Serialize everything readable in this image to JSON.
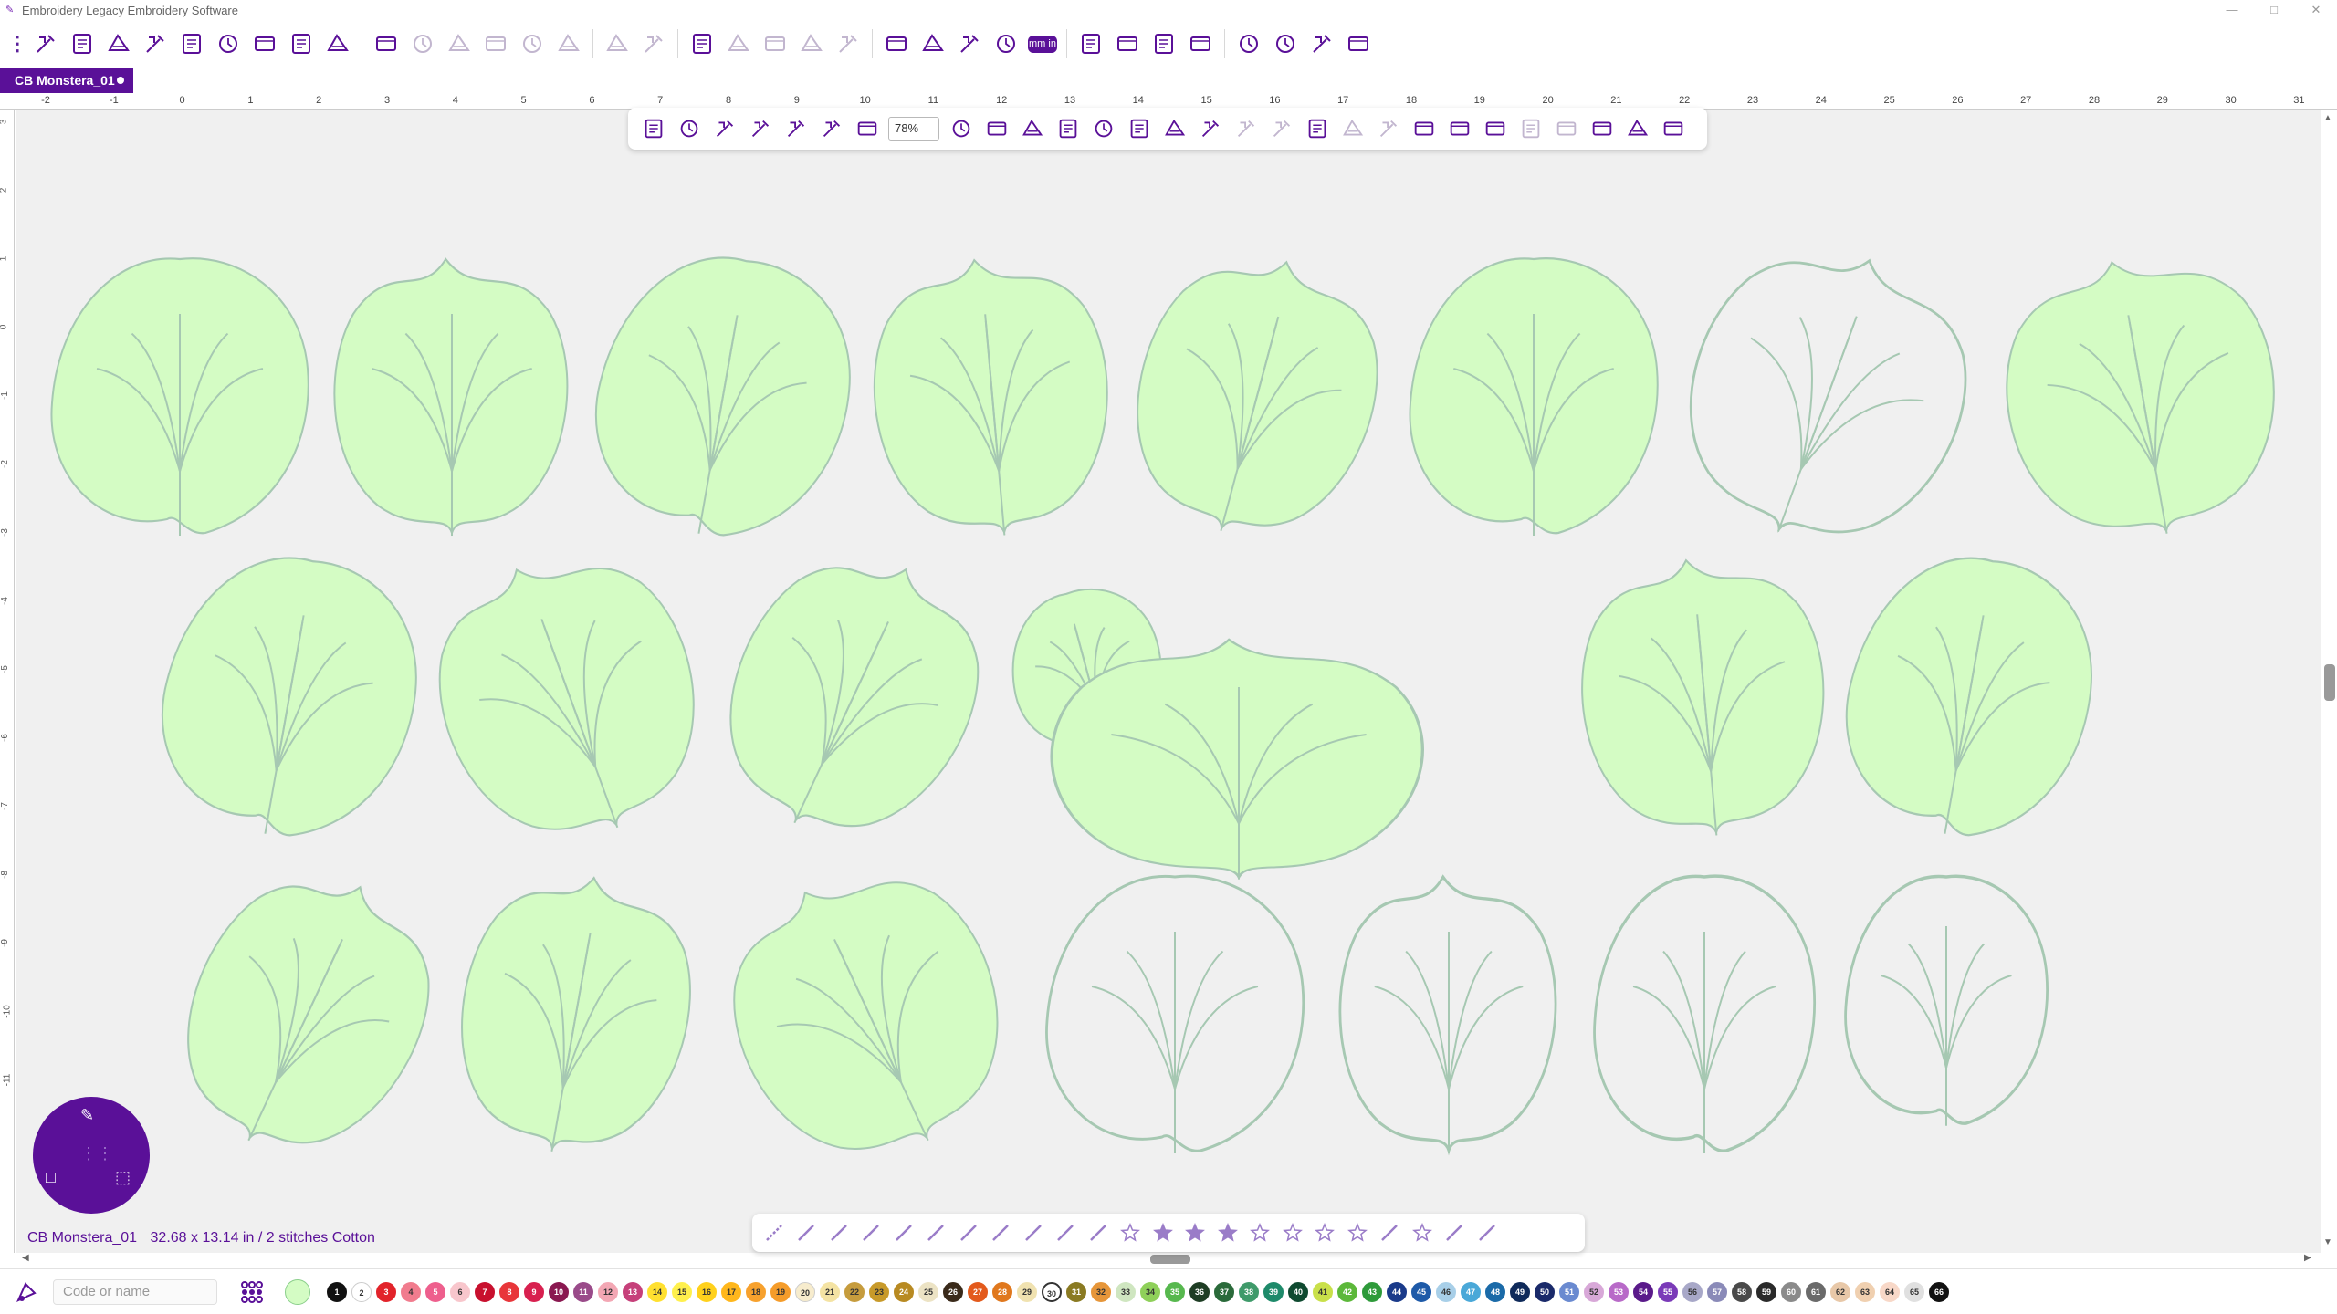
{
  "window": {
    "title": "Embroidery Legacy Embroidery Software",
    "controls": [
      "—",
      "□",
      "✕"
    ]
  },
  "toolbar": {
    "groups": [
      [
        "design-icon",
        "new-icon",
        "edit-icon",
        "open-icon",
        "open-folder-icon",
        "save-icon",
        "save-as-icon",
        "template-icon",
        "print-icon"
      ],
      [
        "undo-icon",
        "redo-icon",
        "cut-icon",
        "copy-icon",
        "paste-icon",
        "delete-icon"
      ],
      [
        "group-icon",
        "ungroup-icon"
      ],
      [
        "rotate-icon",
        "mirror-icon",
        "align-icon",
        "distribute-icon",
        "path-icon"
      ],
      [
        "hoop-icon",
        "grid-icon",
        "measure-icon",
        "center-icon",
        "units-icon"
      ],
      [
        "realistic-icon",
        "layers-toggle-icon",
        "image-icon",
        "frame-icon"
      ],
      [
        "properties-icon",
        "settings-icon",
        "stack-icon",
        "web-icon"
      ]
    ],
    "units_label": "mm in"
  },
  "document": {
    "tab_label": "CB Monstera_01"
  },
  "ruler": {
    "horizontal_ticks": [
      "-2",
      "-1",
      "0",
      "1",
      "2",
      "3",
      "4",
      "5",
      "6",
      "7",
      "8",
      "9",
      "10",
      "11",
      "12",
      "13",
      "14",
      "15",
      "16",
      "17",
      "18",
      "19",
      "20",
      "21",
      "22",
      "23",
      "24",
      "25",
      "26",
      "27",
      "28",
      "29",
      "30",
      "31"
    ],
    "vertical_ticks": [
      "3",
      "2",
      "1",
      "0",
      "-1",
      "-2",
      "-3",
      "-4",
      "-5",
      "-6",
      "-7",
      "-8",
      "-9",
      "-10",
      "-11"
    ]
  },
  "canvas_toolbar": {
    "zoom_value": "78%",
    "icons": [
      "select-icon",
      "lasso-icon",
      "select-box-icon",
      "select-points-icon",
      "3d-view-icon",
      "pan-icon",
      "zoom-icon",
      "zoom-value",
      "monitor-icon",
      "text-icon",
      "text-path-icon",
      "open-folder-icon",
      "save-icon",
      "save-design-icon",
      "edit-stitch-icon",
      "node-edit-icon",
      "curve-icon",
      "convert-icon",
      "arrow-icon",
      "cut-stitch-icon",
      "remove-icon",
      "stitch-player-icon",
      "auto-digitize-icon",
      "fill-icon",
      "applique-icon",
      "magic-icon",
      "density-icon",
      "image-edit-icon",
      "resize-icon"
    ]
  },
  "status_bar": {
    "design_name": "CB Monstera_01",
    "info": "32.68 x 13.14 in / 2 stitches Cotton"
  },
  "stitch_toolbar": {
    "icons": [
      "run-stitch-icon",
      "bean-stitch-icon",
      "motif-stitch-icon",
      "zigzag-stitch-icon",
      "satin-stitch-icon",
      "satin-column-icon",
      "satin-path-icon",
      "fill-stitch-icon",
      "fill-path-icon",
      "cross-stitch-icon",
      "applique-stitch-icon",
      "star-outline-icon",
      "star-fill-icon",
      "star-satin-icon",
      "star-fill2-icon",
      "star-applique-icon",
      "star-run-icon",
      "star-motif-icon",
      "star-cross-icon",
      "redwork-icon",
      "star-shape-icon",
      "applique-shape-icon",
      "center-point-icon"
    ]
  },
  "bottom_bar": {
    "search_placeholder": "Code or name",
    "current_color": "#d4fcc4",
    "palette": [
      {
        "n": "1",
        "c": "#111111"
      },
      {
        "n": "2",
        "c": "#ffffff"
      },
      {
        "n": "3",
        "c": "#e2232a"
      },
      {
        "n": "4",
        "c": "#f17c8e"
      },
      {
        "n": "5",
        "c": "#ee5f8d"
      },
      {
        "n": "6",
        "c": "#f8c6cc"
      },
      {
        "n": "7",
        "c": "#c8102e"
      },
      {
        "n": "8",
        "c": "#e8363a"
      },
      {
        "n": "9",
        "c": "#d8204f"
      },
      {
        "n": "10",
        "c": "#8a1850"
      },
      {
        "n": "11",
        "c": "#9a4b8a"
      },
      {
        "n": "12",
        "c": "#f3a7b4"
      },
      {
        "n": "13",
        "c": "#c6407a"
      },
      {
        "n": "14",
        "c": "#ffe030"
      },
      {
        "n": "15",
        "c": "#fff04d"
      },
      {
        "n": "16",
        "c": "#ffd11c"
      },
      {
        "n": "17",
        "c": "#ffb71c"
      },
      {
        "n": "18",
        "c": "#f7a12d"
      },
      {
        "n": "19",
        "c": "#f59c2a"
      },
      {
        "n": "20",
        "c": "#f7eccd"
      },
      {
        "n": "21",
        "c": "#f4e3a3"
      },
      {
        "n": "22",
        "c": "#c69c3d"
      },
      {
        "n": "23",
        "c": "#c89a2a"
      },
      {
        "n": "24",
        "c": "#b88a22"
      },
      {
        "n": "25",
        "c": "#ece3c4"
      },
      {
        "n": "26",
        "c": "#3a2a1a"
      },
      {
        "n": "27",
        "c": "#e35a1c"
      },
      {
        "n": "28",
        "c": "#e0781e"
      },
      {
        "n": "29",
        "c": "#f0e2b0"
      },
      {
        "n": "30",
        "c": "#ffffff"
      },
      {
        "n": "31",
        "c": "#8a7a22"
      },
      {
        "n": "32",
        "c": "#e6963a"
      },
      {
        "n": "33",
        "c": "#cfe6c0"
      },
      {
        "n": "34",
        "c": "#8fd05a"
      },
      {
        "n": "35",
        "c": "#57b84e"
      },
      {
        "n": "36",
        "c": "#1e3d24"
      },
      {
        "n": "37",
        "c": "#2a6a3a"
      },
      {
        "n": "38",
        "c": "#3f9a6a"
      },
      {
        "n": "39",
        "c": "#1e8a6a"
      },
      {
        "n": "40",
        "c": "#0f4a30"
      },
      {
        "n": "41",
        "c": "#c9e04a"
      },
      {
        "n": "42",
        "c": "#5cb83a"
      },
      {
        "n": "43",
        "c": "#2e9a3a"
      },
      {
        "n": "44",
        "c": "#1a3a8a"
      },
      {
        "n": "45",
        "c": "#1e5aa8"
      },
      {
        "n": "46",
        "c": "#a8cfe8"
      },
      {
        "n": "47",
        "c": "#4aa8d8"
      },
      {
        "n": "48",
        "c": "#1a6aa8"
      },
      {
        "n": "49",
        "c": "#0f2a5a"
      },
      {
        "n": "50",
        "c": "#1a2a6a"
      },
      {
        "n": "51",
        "c": "#6a8ad0"
      },
      {
        "n": "52",
        "c": "#d8a8d8"
      },
      {
        "n": "53",
        "c": "#b86ac8"
      },
      {
        "n": "54",
        "c": "#5a1a8a"
      },
      {
        "n": "55",
        "c": "#7a3ab8"
      },
      {
        "n": "56",
        "c": "#a8a8c8"
      },
      {
        "n": "57",
        "c": "#8a8ab8"
      },
      {
        "n": "58",
        "c": "#4a4a4a"
      },
      {
        "n": "59",
        "c": "#2a2a2a"
      },
      {
        "n": "60",
        "c": "#8a8a8a"
      },
      {
        "n": "61",
        "c": "#6a6a6a"
      },
      {
        "n": "62",
        "c": "#e8c8a8"
      },
      {
        "n": "63",
        "c": "#f0d0b0"
      },
      {
        "n": "64",
        "c": "#f8d8c8"
      },
      {
        "n": "65",
        "c": "#e0e0e0"
      },
      {
        "n": "66",
        "c": "#111111"
      }
    ]
  },
  "colors": {
    "brand": "#5a1098",
    "leaf_fill": "#d4fcc4",
    "leaf_stroke": "#a6c8b2",
    "canvas_bg": "#f0f0f0"
  }
}
